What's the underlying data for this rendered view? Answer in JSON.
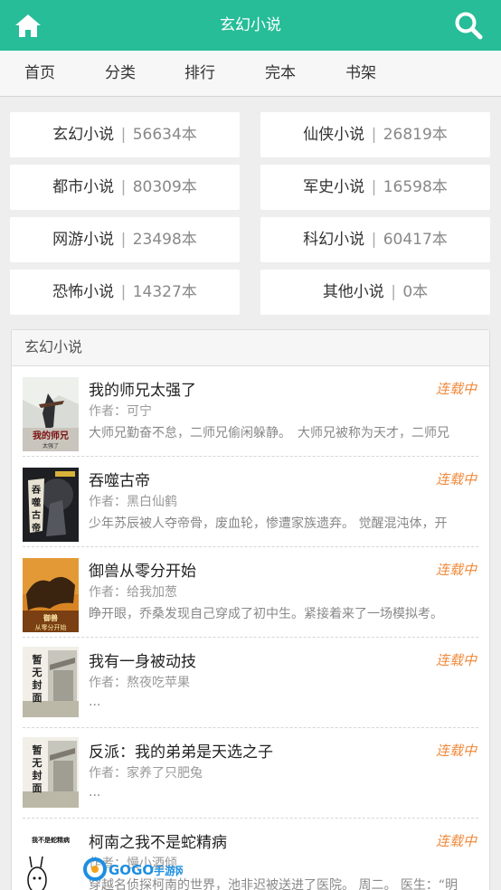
{
  "header": {
    "title": "玄幻小说",
    "home_icon": "home-icon",
    "search_icon": "search-icon",
    "bg_color": "#26bd98"
  },
  "nav": {
    "items": [
      "首页",
      "分类",
      "排行",
      "完本",
      "书架"
    ]
  },
  "categories": [
    {
      "name": "玄幻小说",
      "sep": "|",
      "count": "56634本"
    },
    {
      "name": "仙侠小说",
      "sep": "|",
      "count": "26819本"
    },
    {
      "name": "都市小说",
      "sep": "|",
      "count": "80309本"
    },
    {
      "name": "军史小说",
      "sep": "|",
      "count": "16598本"
    },
    {
      "name": "网游小说",
      "sep": "|",
      "count": "23498本"
    },
    {
      "name": "科幻小说",
      "sep": "|",
      "count": "60417本"
    },
    {
      "name": "恐怖小说",
      "sep": "|",
      "count": "14327本"
    },
    {
      "name": "其他小说",
      "sep": "|",
      "count": "0本"
    }
  ],
  "section": {
    "title": "玄幻小说"
  },
  "books": [
    {
      "title": "我的师兄太强了",
      "status": "连载中",
      "author": "作者：可宁",
      "desc": "大师兄勤奋不怠，二师兄偷闲躲静。　大师兄被称为天才，二师兄",
      "cover_text": "我的师兄太强了"
    },
    {
      "title": "吞噬古帝",
      "status": "连载中",
      "author": "作者：黑白仙鹤",
      "desc": "少年苏辰被人夺帝骨，废血轮，惨遭家族遗弃。 觉醒混沌体，开",
      "cover_text": "吞噬古帝"
    },
    {
      "title": "御兽从零分开始",
      "status": "连载中",
      "author": "作者：给我加葱",
      "desc": "睁开眼，乔桑发现自己穿成了初中生。紧接着来了一场模拟考。",
      "cover_text": "御兽从零分开始"
    },
    {
      "title": "我有一身被动技",
      "status": "连载中",
      "author": "作者：熬夜吃苹果",
      "desc": "...",
      "cover_text": "暂无封面"
    },
    {
      "title": "反派：我的弟弟是天选之子",
      "status": "连载中",
      "author": "作者：家养了只肥兔",
      "desc": "...",
      "cover_text": "暂无封面"
    },
    {
      "title": "柯南之我不是蛇精病",
      "status": "连载中",
      "author": "作者：慢小酒倾",
      "desc": "穿越名侦探柯南的世界，池非迟被送进了医院。 周二。 医生：“明",
      "cover_text": "我不是蛇精病"
    }
  ],
  "watermark": {
    "text": "GOGO手游网",
    "domain": "gogo.com"
  },
  "colors": {
    "status": "#f0893a",
    "accent": "#26bd98"
  }
}
